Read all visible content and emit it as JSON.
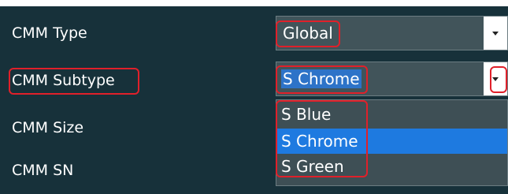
{
  "fields": {
    "cmm_type_label": "CMM Type",
    "cmm_subtype_label": "CMM Subtype",
    "cmm_size_label": "CMM Size",
    "cmm_sn_label": "CMM SN"
  },
  "cmm_type_select": {
    "value": "Global"
  },
  "cmm_subtype_select": {
    "value": "S Chrome"
  },
  "dropdown": {
    "options": [
      {
        "label": "S Blue"
      },
      {
        "label": "S Chrome"
      },
      {
        "label": "S Green"
      }
    ],
    "selected_index": 1
  },
  "icons": {
    "dropdown_arrow": "chevron-down-icon"
  },
  "colors": {
    "panel_bg": "#17313a",
    "select_bg": "#41545a",
    "selection_blue": "#1e7ae0",
    "annotation_red": "#e0202a"
  }
}
